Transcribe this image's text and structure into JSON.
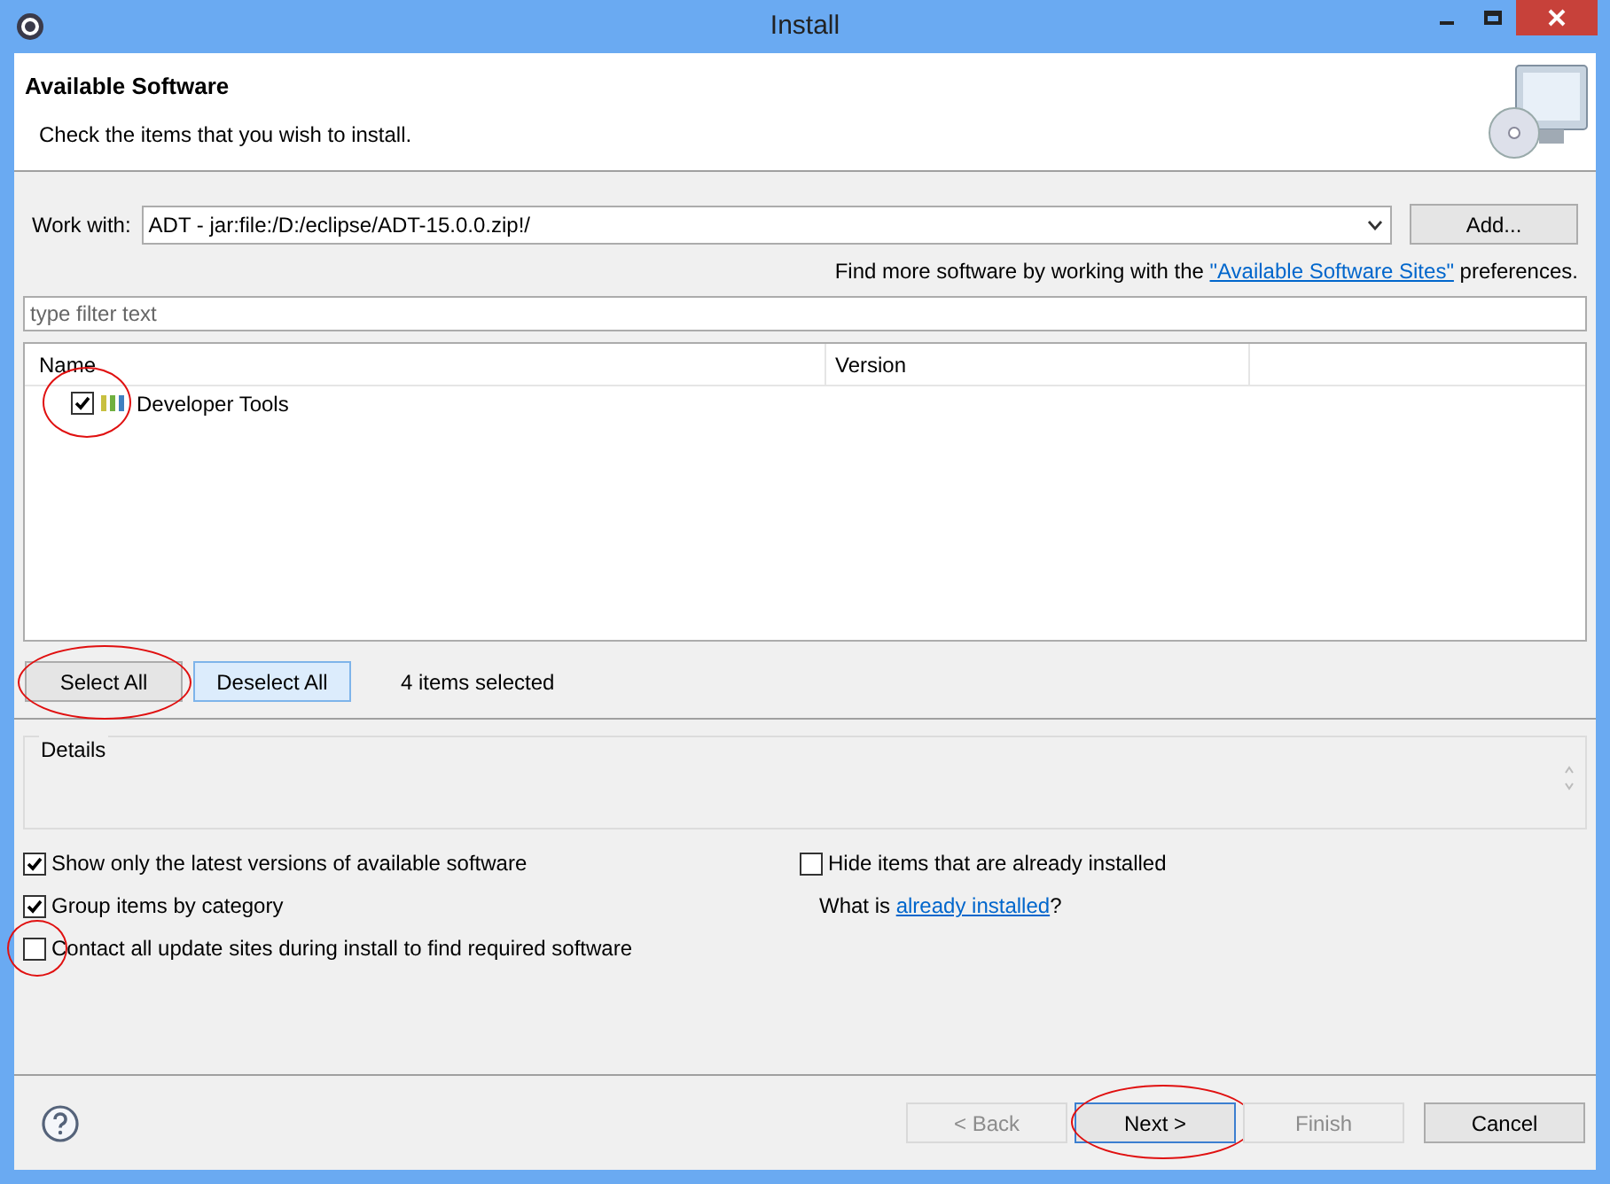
{
  "window": {
    "title": "Install"
  },
  "header": {
    "title": "Available Software",
    "subtitle": "Check the items that you wish to install."
  },
  "work_with": {
    "label": "Work with:",
    "value": "ADT - jar:file:/D:/eclipse/ADT-15.0.0.zip!/",
    "button": "Add..."
  },
  "sites_hint": {
    "before": "Find more software by working with the ",
    "link": "\"Available Software Sites\"",
    "after": " preferences."
  },
  "filter": {
    "placeholder": "type filter text"
  },
  "table": {
    "columns": [
      "Name",
      "Version"
    ],
    "rows": [
      {
        "name": "Developer Tools",
        "checked": true,
        "circled": true
      }
    ]
  },
  "selection_buttons": [
    {
      "label": "Select All",
      "focused": false,
      "circled": true
    },
    {
      "label": "Deselect All",
      "focused": true,
      "circled": false
    }
  ],
  "selection_count": "4 items selected",
  "details": {
    "title": "Details"
  },
  "options_left": [
    {
      "label": "Show only the latest versions of available software",
      "checked": true,
      "circled": false
    },
    {
      "label": "Group items by category",
      "checked": true,
      "circled": false
    },
    {
      "label": "Contact all update sites during install to find required software",
      "checked": false,
      "circled": true
    }
  ],
  "options_right": {
    "hide_installed": {
      "label": "Hide items that are already installed",
      "checked": false
    },
    "what_is": {
      "before": "What is ",
      "link": "already installed",
      "after": "?"
    }
  },
  "footer_buttons": [
    {
      "label": "< Back",
      "disabled": true,
      "focused": false,
      "circled": false
    },
    {
      "label": "Next >",
      "disabled": false,
      "focused": true,
      "circled": true
    },
    {
      "label": "Finish",
      "disabled": true,
      "focused": false,
      "circled": false
    },
    {
      "label": "Cancel",
      "disabled": false,
      "focused": false,
      "circled": false
    }
  ]
}
